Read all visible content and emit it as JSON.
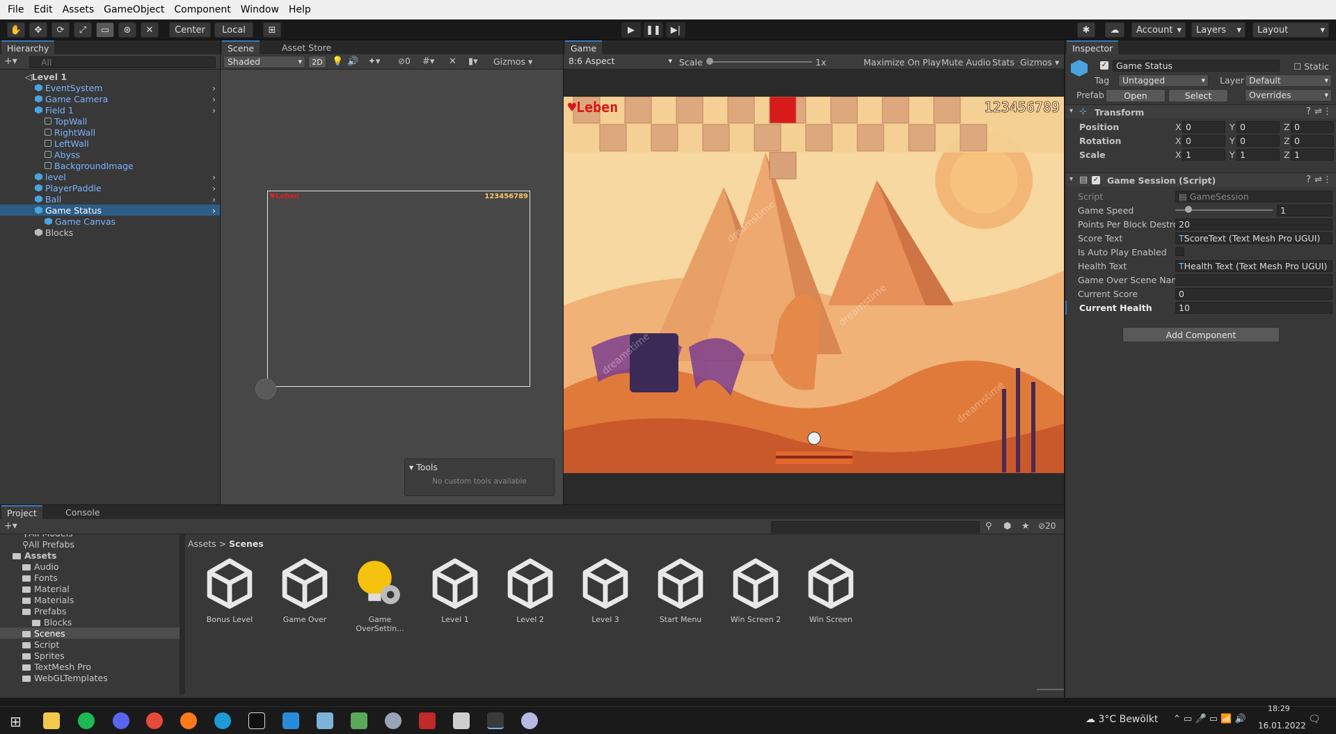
{
  "menu": [
    "File",
    "Edit",
    "Assets",
    "GameObject",
    "Component",
    "Window",
    "Help"
  ],
  "toolbar": {
    "pivot": "Center",
    "space": "Local",
    "account": "Account",
    "layers": "Layers",
    "layout": "Layout"
  },
  "hierarchy": {
    "tab": "Hierarchy",
    "search_placeholder": "All",
    "items": [
      {
        "label": "Level 1",
        "indent": 0,
        "type": "scene"
      },
      {
        "label": "EventSystem",
        "indent": 1,
        "type": "blue"
      },
      {
        "label": "Game Camera",
        "indent": 1,
        "type": "blue"
      },
      {
        "label": "Field 1",
        "indent": 1,
        "type": "blue"
      },
      {
        "label": "TopWall",
        "indent": 2,
        "type": "hollow"
      },
      {
        "label": "RightWall",
        "indent": 2,
        "type": "hollow"
      },
      {
        "label": "LeftWall",
        "indent": 2,
        "type": "hollow"
      },
      {
        "label": "Abyss",
        "indent": 2,
        "type": "hollow"
      },
      {
        "label": "BackgroundImage",
        "indent": 2,
        "type": "hollow"
      },
      {
        "label": "level",
        "indent": 1,
        "type": "blue"
      },
      {
        "label": "PlayerPaddle",
        "indent": 1,
        "type": "blue"
      },
      {
        "label": "Ball",
        "indent": 1,
        "type": "blue"
      },
      {
        "label": "Game Status",
        "indent": 1,
        "type": "selected"
      },
      {
        "label": "Game Canvas",
        "indent": 2,
        "type": "blue"
      },
      {
        "label": "Blocks",
        "indent": 1,
        "type": "white"
      }
    ]
  },
  "scene": {
    "tabs": [
      "Scene",
      "Asset Store"
    ],
    "shading": "Shaded",
    "mode2d": "2D",
    "hidden_count": "0",
    "gizmos": "Gizmos",
    "tools_title": "Tools",
    "tools_msg": "No custom tools available",
    "mini_health": "♥Leben",
    "mini_score": "123456789"
  },
  "game": {
    "tab": "Game",
    "aspect": "8:6 Aspect",
    "scale_label": "Scale",
    "scale_value": "1x",
    "maximize": "Maximize On Play",
    "mute": "Mute Audio",
    "stats": "Stats",
    "gizmos": "Gizmos",
    "health_text": "♥Leben",
    "score_text": "123456789",
    "watermark": "dreamstime",
    "colors": {
      "sky": "#f6d8a0",
      "dune": "#e07a3a",
      "block": "#d9a27a",
      "red_block": "#d71a1a",
      "pyramid": "#e89a64"
    }
  },
  "inspector": {
    "tab": "Inspector",
    "object_name": "Game Status",
    "static": "Static",
    "tag_label": "Tag",
    "tag_value": "Untagged",
    "layer_label": "Layer",
    "layer_value": "Default",
    "prefab_label": "Prefab",
    "open": "Open",
    "select": "Select",
    "overrides": "Overrides",
    "transform": {
      "title": "Transform",
      "rows": [
        {
          "label": "Position",
          "x": "0",
          "y": "0",
          "z": "0"
        },
        {
          "label": "Rotation",
          "x": "0",
          "y": "0",
          "z": "0"
        },
        {
          "label": "Scale",
          "x": "1",
          "y": "1",
          "z": "1"
        }
      ]
    },
    "session": {
      "title": "Game Session (Script)",
      "script_label": "Script",
      "script_value": "GameSession",
      "speed_label": "Game Speed",
      "speed_value": "1",
      "points_label": "Points Per Block Destro",
      "points_value": "20",
      "score_label": "Score Text",
      "score_value": "ScoreText (Text Mesh Pro UGUI)",
      "autoplay_label": "Is Auto Play Enabled",
      "health_label": "Health Text",
      "health_value": "Health Text (Text Mesh Pro UGUI)",
      "gameover_label": "Game Over Scene Name",
      "gameover_value": "",
      "curscore_label": "Current Score",
      "curscore_value": "0",
      "curhealth_label": "Current Health",
      "curhealth_value": "10"
    },
    "add_component": "Add Component"
  },
  "project": {
    "tabs": [
      "Project",
      "Console"
    ],
    "hidden_count": "20",
    "tree": [
      {
        "label": "All Models",
        "indent": 1,
        "kind": "search"
      },
      {
        "label": "All Prefabs",
        "indent": 1,
        "kind": "search"
      },
      {
        "label": "Assets",
        "indent": 0,
        "kind": "folder"
      },
      {
        "label": "Audio",
        "indent": 1,
        "kind": "folder"
      },
      {
        "label": "Fonts",
        "indent": 1,
        "kind": "folder"
      },
      {
        "label": "Material",
        "indent": 1,
        "kind": "folder"
      },
      {
        "label": "Materials",
        "indent": 1,
        "kind": "folder"
      },
      {
        "label": "Prefabs",
        "indent": 1,
        "kind": "folder"
      },
      {
        "label": "Blocks",
        "indent": 2,
        "kind": "folder"
      },
      {
        "label": "Scenes",
        "indent": 1,
        "kind": "folder"
      },
      {
        "label": "Script",
        "indent": 1,
        "kind": "folder"
      },
      {
        "label": "Sprites",
        "indent": 1,
        "kind": "folder"
      },
      {
        "label": "TextMesh Pro",
        "indent": 1,
        "kind": "folder"
      },
      {
        "label": "WebGLTemplates",
        "indent": 1,
        "kind": "folder"
      }
    ],
    "breadcrumb": [
      "Assets",
      "Scenes"
    ],
    "assets": [
      "Bonus Level",
      "Game Over",
      "Game OverSettin...",
      "Level 1",
      "Level 2",
      "Level 3",
      "Start Menu",
      "Win Screen 2",
      "Win Screen"
    ]
  },
  "taskbar": {
    "weather": "3°C Bewölkt",
    "time": "18:29",
    "date": "16.01.2022"
  }
}
